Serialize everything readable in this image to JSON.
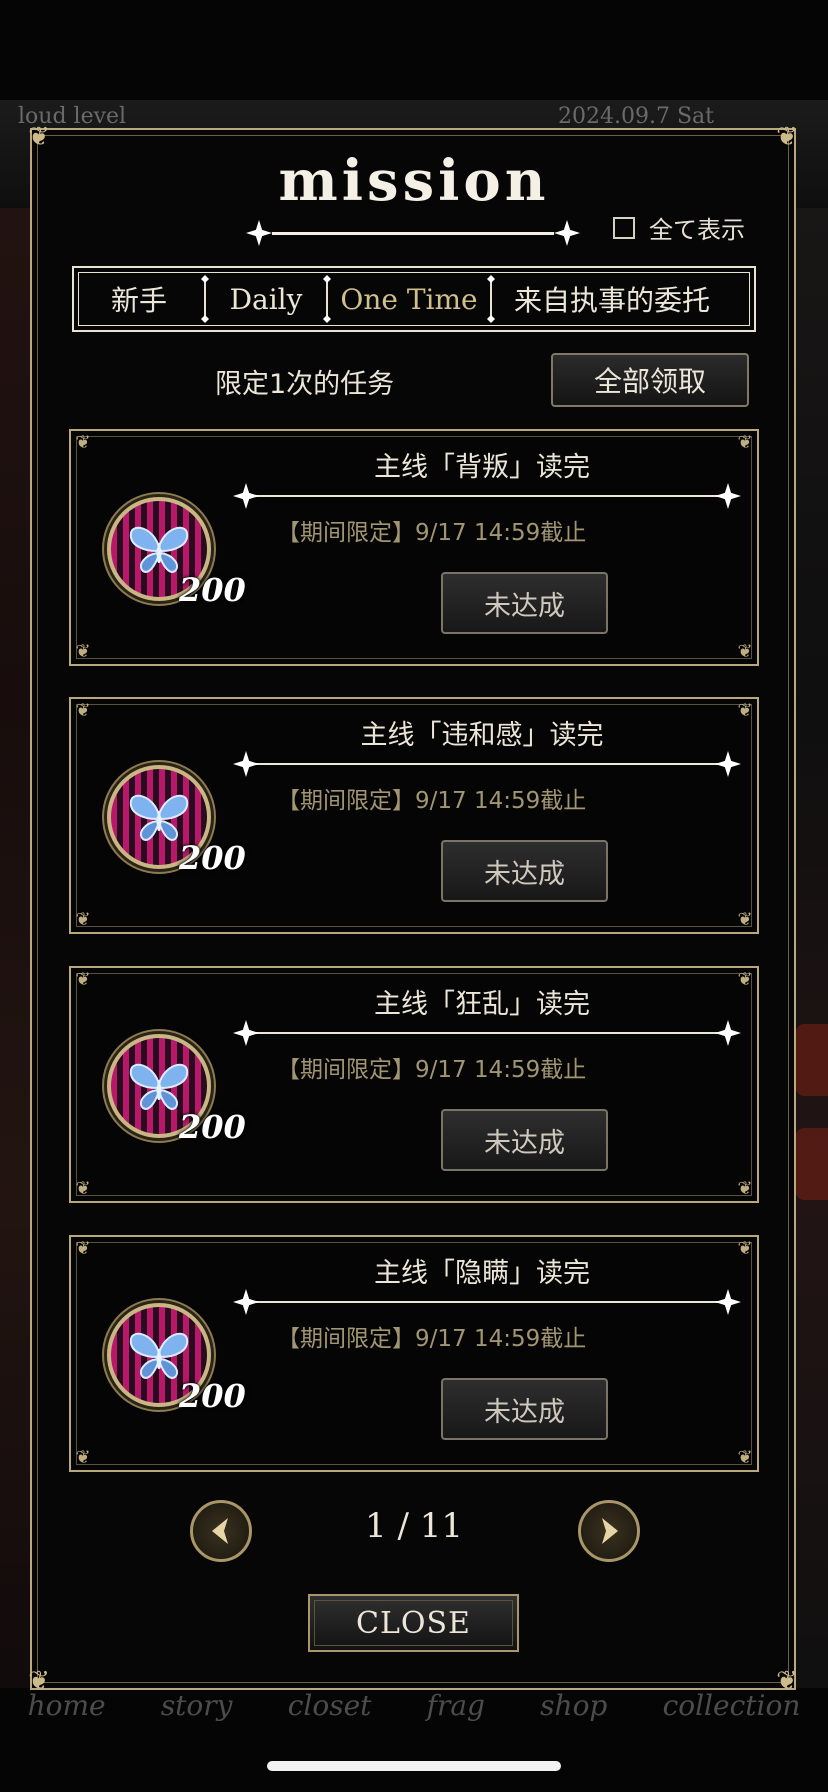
{
  "background": {
    "topbar_left": "loud level",
    "topbar_date": "2024.09.7 Sat",
    "nav_items": [
      "home",
      "story",
      "closet",
      "frag",
      "shop",
      "collection"
    ]
  },
  "modal": {
    "title": "mission",
    "show_all_label": "全て表示",
    "tabs": [
      {
        "label": "新手",
        "active": false
      },
      {
        "label": "Daily",
        "active": false
      },
      {
        "label": "One Time",
        "active": true
      },
      {
        "label": "来自执事的委托",
        "active": false
      }
    ],
    "section_title": "限定1次的任务",
    "claim_all_label": "全部领取",
    "missions": [
      {
        "title": "主线「背叛」读完",
        "deadline": "【期间限定】9/17 14:59截止",
        "reward_icon": "blue-butterfly-icon",
        "reward_count": "200",
        "status": "未达成"
      },
      {
        "title": "主线「违和感」读完",
        "deadline": "【期间限定】9/17 14:59截止",
        "reward_icon": "blue-butterfly-icon",
        "reward_count": "200",
        "status": "未达成"
      },
      {
        "title": "主线「狂乱」读完",
        "deadline": "【期间限定】9/17 14:59截止",
        "reward_icon": "blue-butterfly-icon",
        "reward_count": "200",
        "status": "未达成"
      },
      {
        "title": "主线「隐瞒」读完",
        "deadline": "【期间限定】9/17 14:59截止",
        "reward_icon": "blue-butterfly-icon",
        "reward_count": "200",
        "status": "未达成"
      }
    ],
    "pagination": "1 / 11",
    "close_label": "CLOSE"
  },
  "colors": {
    "gold": "#b9a980",
    "active_tab": "#cfc08e",
    "deadline_text": "#a29572",
    "reward_stripe_pink": "#b8186a"
  }
}
